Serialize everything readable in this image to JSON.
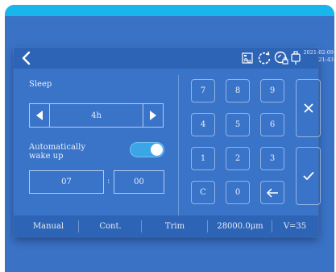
{
  "header": {
    "date": "2021-02-09",
    "time": "21:43",
    "icons": [
      "back-icon",
      "signal-chart-icon",
      "refresh-icon",
      "lock-badge-icon",
      "device-icon"
    ]
  },
  "sleep": {
    "label": "Sleep",
    "value": "4h"
  },
  "auto_wake": {
    "label_line1": "Automatically",
    "label_line2": "wake up",
    "enabled": true
  },
  "wake_time": {
    "hour": "07",
    "separator": ":",
    "minute": "00"
  },
  "keypad": {
    "k7": "7",
    "k8": "8",
    "k9": "9",
    "k4": "4",
    "k5": "5",
    "k6": "6",
    "k1": "1",
    "k2": "2",
    "k3": "3",
    "kc": "C",
    "k0": "0"
  },
  "footer": {
    "manual": "Manual",
    "cont": "Cont.",
    "trim": "Trim",
    "position": "28000.0μm",
    "velocity": "V=35"
  },
  "colors": {
    "panel": "#3a74c9",
    "header": "#2e64b6",
    "toggle_on": "#3aa6e8",
    "accent_cyan": "#19b6ee"
  }
}
